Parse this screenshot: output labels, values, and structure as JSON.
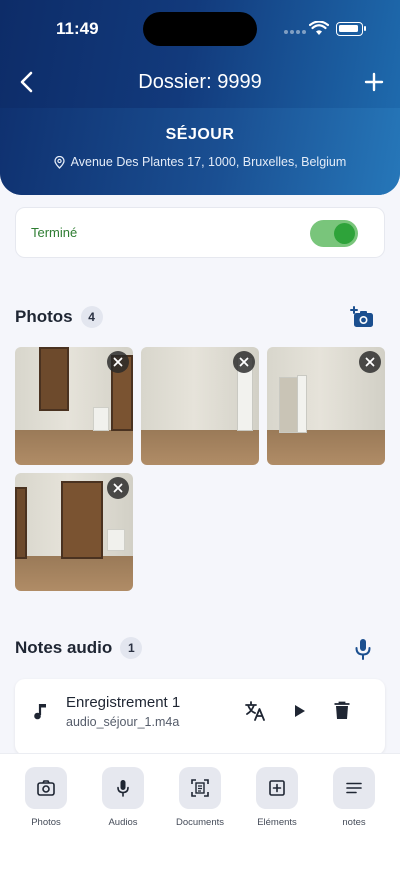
{
  "status_bar": {
    "time": "11:49"
  },
  "nav": {
    "title": "Dossier: 9999"
  },
  "room": {
    "name": "SÉJOUR",
    "address": "Avenue Des Plantes 17, 1000, Bruxelles, Belgium"
  },
  "status": {
    "label": "Terminé",
    "toggle_on": true,
    "toggle_color": "#2ea33a"
  },
  "photos": {
    "heading": "Photos",
    "count": "4",
    "items": [
      {
        "subject": "room-french-door"
      },
      {
        "subject": "room-open-white-door"
      },
      {
        "subject": "room-corner-doorway"
      },
      {
        "subject": "room-french-door-wide"
      }
    ]
  },
  "audio": {
    "heading": "Notes audio",
    "count": "1",
    "items": [
      {
        "name": "Enregistrement 1",
        "file": "audio_séjour_1.m4a"
      }
    ]
  },
  "tabbar": {
    "items": [
      {
        "label": "Photos",
        "icon": "camera-icon"
      },
      {
        "label": "Audios",
        "icon": "microphone-icon"
      },
      {
        "label": "Documents",
        "icon": "document-scan-icon"
      },
      {
        "label": "Eléments",
        "icon": "add-box-icon"
      },
      {
        "label": "notes",
        "icon": "notes-icon"
      }
    ]
  },
  "colors": {
    "header_dark": "#0d2c68",
    "header_light": "#1f6db0",
    "accent": "#1b4f8f",
    "success": "#2e7d32"
  }
}
